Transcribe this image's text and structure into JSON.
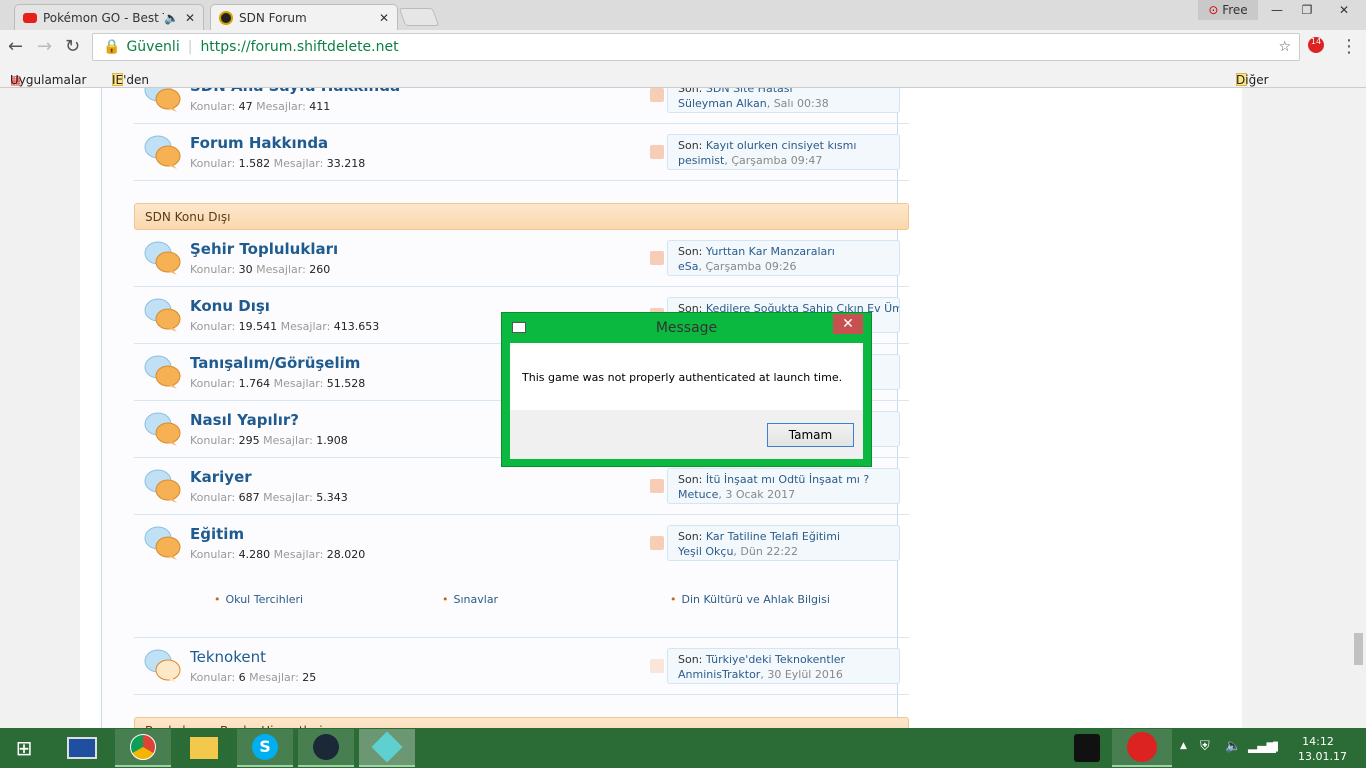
{
  "browser": {
    "tabs": [
      {
        "title": "Pokémon GO - Best Tips",
        "active": false
      },
      {
        "title": "SDN Forum",
        "active": true
      }
    ],
    "secure_label": "Güvenli",
    "url": "https://forum.shiftdelete.net",
    "profile_label": "Free",
    "ext_badge": "14",
    "bookmarks": [
      "Uygulamalar",
      "IE'den Al"
    ],
    "other_bookmarks": "Diğer yer işaretleri"
  },
  "forum": {
    "konular_label": "Konular:",
    "mesajlar_label": "Mesajlar:",
    "son_label": "Son:",
    "sections": [
      {
        "type": "row",
        "title": "SDN Ana Sayfa Hakkında",
        "konular": "47",
        "mesajlar": "411",
        "last_title": "SDN Site Hatası",
        "last_user": "Süleyman Alkan",
        "last_date": "Salı 00:38"
      },
      {
        "type": "row",
        "title": "Forum Hakkında",
        "konular": "1.582",
        "mesajlar": "33.218",
        "last_title": "Kayıt olurken cinsiyet kısmı",
        "last_user": "pesimist",
        "last_date": "Çarşamba 09:47"
      },
      {
        "type": "cat",
        "title": "SDN Konu Dışı"
      },
      {
        "type": "row",
        "title": "Şehir Toplulukları",
        "konular": "30",
        "mesajlar": "260",
        "last_title": "Yurttan Kar Manzaraları",
        "last_user": "eSa",
        "last_date": "Çarşamba 09:26"
      },
      {
        "type": "row",
        "title": "Konu Dışı",
        "konular": "19.541",
        "mesajlar": "413.653",
        "last_title": "Kedilere Soğukta Sahip Çıkın Ev Üm...",
        "last_user": "",
        "last_date": ""
      },
      {
        "type": "row",
        "title": "Tanışalım/Görüşelim",
        "konular": "1.764",
        "mesajlar": "51.528",
        "last_title": "",
        "last_user": "",
        "last_date": ""
      },
      {
        "type": "row",
        "title": "Nasıl Yapılır?",
        "konular": "295",
        "mesajlar": "1.908",
        "last_title": "",
        "last_user": "",
        "last_date": ""
      },
      {
        "type": "row",
        "title": "Kariyer",
        "konular": "687",
        "mesajlar": "5.343",
        "last_title": "İtü İnşaat mı Odtü İnşaat mı ?",
        "last_user": "Metuce",
        "last_date": "3 Ocak 2017"
      },
      {
        "type": "row",
        "title": "Eğitim",
        "konular": "4.280",
        "mesajlar": "28.020",
        "last_title": "Kar Tatiline Telafi Eğitimi",
        "last_user": "Yeşil Okçu",
        "last_date": "Dün 22:22",
        "subforums": [
          "Okul Tercihleri",
          "Sınavlar",
          "Din Kültürü ve Ahlak Bilgisi"
        ]
      },
      {
        "type": "row",
        "title": "Teknokent",
        "konular": "6",
        "mesajlar": "25",
        "last_title": "Türkiye'deki Teknokentler",
        "last_user": "AnminisTraktor",
        "last_date": "30 Eylül 2016",
        "read": true
      },
      {
        "type": "cat",
        "title": "Bankalar ve Banka Hizmetleri"
      }
    ]
  },
  "dialog": {
    "title": "Message",
    "message": "This game was not properly authenticated at launch time.",
    "ok": "Tamam"
  },
  "taskbar": {
    "time": "14:12",
    "date": "13.01.17"
  }
}
